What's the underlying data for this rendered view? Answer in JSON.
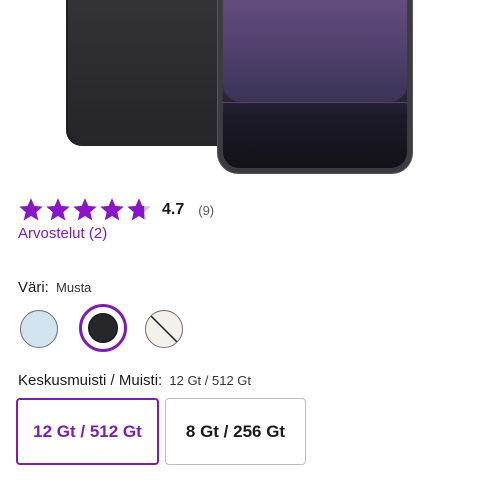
{
  "rating": {
    "value": "4.7",
    "count": "(9)",
    "stars_value": 4.7,
    "stars_max": 5,
    "reviews_link": "Arvostelut (2)"
  },
  "color": {
    "label": "Väri:",
    "selected": "Musta",
    "options": [
      {
        "name": "light-blue",
        "hex": "#d3e4f1",
        "selected": false
      },
      {
        "name": "black",
        "hex": "#26262b",
        "selected": true
      },
      {
        "name": "white",
        "hex": "#f4f1ec",
        "selected": false,
        "unavailable": true
      }
    ]
  },
  "memory": {
    "label": "Keskusmuisti / Muisti:",
    "selected": "12 Gt / 512 Gt",
    "options": [
      {
        "label": "12 Gt / 512 Gt",
        "selected": true
      },
      {
        "label": "8 Gt / 256 Gt",
        "selected": false
      }
    ]
  },
  "colors": {
    "accent": "#7a1fb0",
    "star": "#8a14c8",
    "star_empty": "#c8c8c8"
  }
}
